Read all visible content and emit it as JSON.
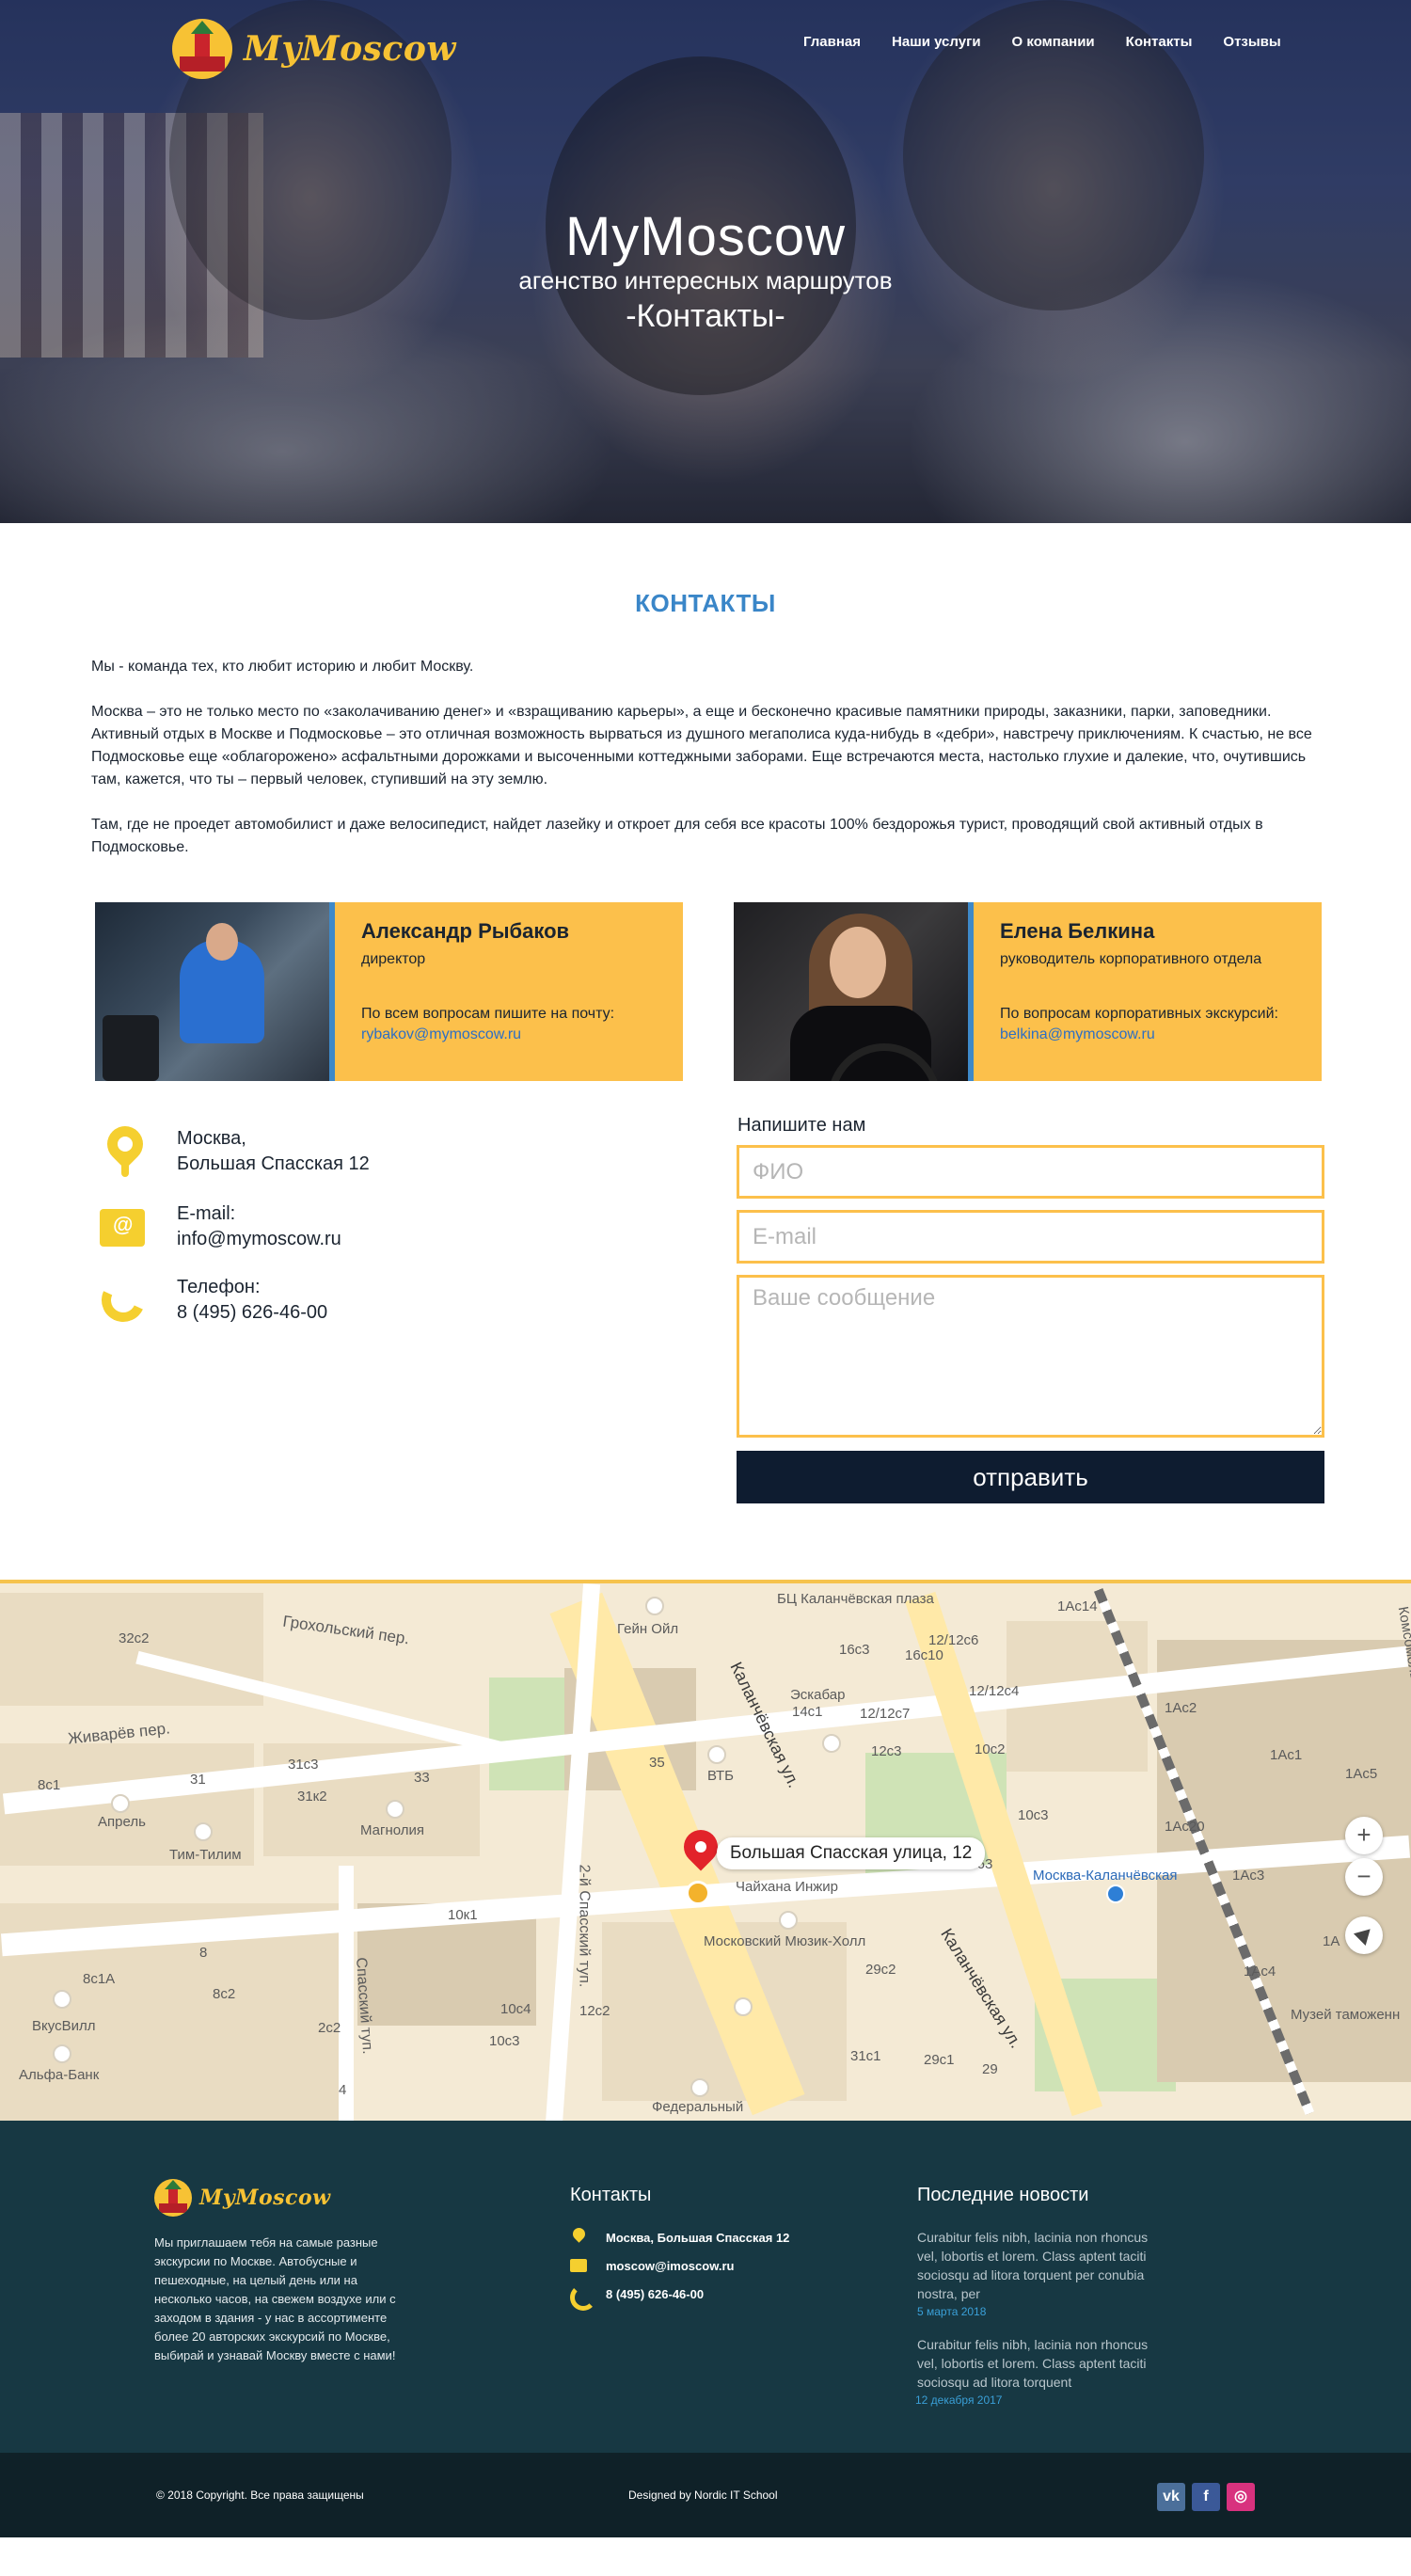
{
  "brand": {
    "name": "MyMoscow"
  },
  "nav": {
    "items": [
      "Главная",
      "Наши услуги",
      "О компании",
      "Контакты",
      "Отзывы"
    ]
  },
  "hero": {
    "title": "MyMoscow",
    "subtitle": "агенство интересных маршрутов",
    "page": "-Контакты-"
  },
  "contacts_section": {
    "title": "КОНТАКТЫ",
    "paragraphs": [
      "Мы - команда тех, кто любит историю и любит Москву.",
      "Москва – это не только место по «заколачиванию денег» и «взращиванию карьеры», а еще и бесконечно красивые памятники природы, заказники, парки, заповедники. Активный отдых в Москве и Подмосковье – это отличная возможность вырваться из душного мегаполиса куда-нибудь в «дебри», навстречу приключениям. К счастью, не все Подмосковье еще «облагорожено» асфальтными дорожками и высоченными коттеджными заборами. Еще встречаются места, настолько глухие и далекие, что, очутившись там, кажется, что ты – первый человек, ступивший на эту землю.",
      "Там, где не проедет автомобилист и даже велосипедист, найдет лазейку и откроет для себя все красоты 100% бездорожья турист, проводящий свой активный отдых в Подмосковье."
    ]
  },
  "team": [
    {
      "name": "Александр Рыбаков",
      "role": "директор",
      "note": "По всем вопросам пишите на почту:",
      "email": "rybakov@mymoscow.ru"
    },
    {
      "name": "Елена Белкина",
      "role": "руководитель корпоративного отдела",
      "note": "По вопросам корпоративных экскурсий:",
      "email": "belkina@mymoscow.ru"
    }
  ],
  "info": {
    "address_line1": "Москва,",
    "address_line2": "Большая Спасская 12",
    "email_label": "E-mail:",
    "email": "info@mymoscow.ru",
    "phone_label": "Телефон:",
    "phone": "8 (495) 626-46-00"
  },
  "form": {
    "title": "Напишите нам",
    "name_placeholder": "ФИО",
    "email_placeholder": "E-mail",
    "message_placeholder": "Ваше сообщение",
    "submit": "отправить"
  },
  "map": {
    "pin_label": "Большая Спасская улица, 12",
    "zoom_in": "+",
    "zoom_out": "−",
    "labels": {
      "kalanchevskaya1": "Каланчёвская ул.",
      "kalanchevskaya2": "Каланчёвская ул.",
      "groholsky": "Грохольский пер.",
      "zhivarev": "Живарёв пер.",
      "spassky2": "2-й Спасский туп.",
      "spassky": "Спасский туп.",
      "station": "Москва-Каланчёвская",
      "plaza": "БЦ Каланчёвская плаза",
      "komsomol": "Комсомольская",
      "gein": "Гейн Ойл",
      "vtb": "ВТБ",
      "eskabar": "Эскабар",
      "chaihana": "Чайхана Инжир",
      "music": "Московский Мюзик-Холл",
      "federal": "Федеральный",
      "april": "Апрель",
      "timtilim": "Тим-Тилим",
      "magnolia": "Магнолия",
      "vkusvill": "ВкусВилл",
      "alfa": "Альфа-Банк",
      "museum": "Музей таможенн",
      "b32c2": "32с2",
      "b16c10": "16с10",
      "b16c3": "16с3",
      "b12c12c6": "12/12с6",
      "b1ac14": "1Ас14",
      "b14c1": "14с1",
      "b12c12c7": "12/12с7",
      "b12c12c4": "12/12с4",
      "b1ac2": "1Ас2",
      "b12c3": "12с3",
      "b10c2": "10с2",
      "b1ac1": "1Ас1",
      "b1ac5": "1Ас5",
      "b35": "35",
      "b31c3": "31с3",
      "b33": "33",
      "b31": "31",
      "b31k2": "31к2",
      "b8c1": "8с1",
      "b10c3": "10с3",
      "b1ac20": "1Ас20",
      "b1ac3": "1Ас3",
      "b0463": "0463",
      "b10k1": "10к1",
      "b8": "8",
      "b8c1a": "8с1А",
      "b8c2": "8с2",
      "b2c2": "2с2",
      "b10c4": "10с4",
      "b12c2": "12с2",
      "b29c2": "29с2",
      "b1a": "1А",
      "b1ac4": "1Ас4",
      "b10c3b": "10с3",
      "b31c1": "31с1",
      "b29c1": "29с1",
      "b29": "29",
      "b4": "4"
    }
  },
  "footer": {
    "about": "Мы приглашаем тебя на самые разные экскурсии по Москве. Автобусные и пешеходные, на целый день или на несколько часов, на свежем воздухе или с заходом в здания - у нас в ассортименте более 20 авторских экскурсий по Москве, выбирай и узнавай Москву вместе с нами!",
    "contacts_title": "Контакты",
    "address": "Москва, Большая Спасская 12",
    "email": "moscow@imoscow.ru",
    "phone": "8 (495) 626-46-00",
    "news_title": "Последние новости",
    "news": [
      {
        "text": "Curabitur felis nibh, lacinia non rhoncus vel, lobortis et lorem. Class aptent taciti sociosqu ad litora torquent per conubia nostra, per",
        "date": "5 марта 2018"
      },
      {
        "text": "Curabitur felis nibh, lacinia non rhoncus vel, lobortis et lorem. Class aptent taciti sociosqu ad litora torquent",
        "date": "12 декабря 2017"
      }
    ],
    "copyright": "© 2018 Copyright. Все права защищены",
    "designed": "Designed by Nordic IT School",
    "social": {
      "vk": "vk",
      "fb": "f",
      "ig": "◎"
    }
  },
  "colors": {
    "accent": "#fcc04b",
    "title_blue": "#3a86c8",
    "button": "#0e1c30",
    "footer": "#173843",
    "footer_bottom": "#0f2128"
  }
}
